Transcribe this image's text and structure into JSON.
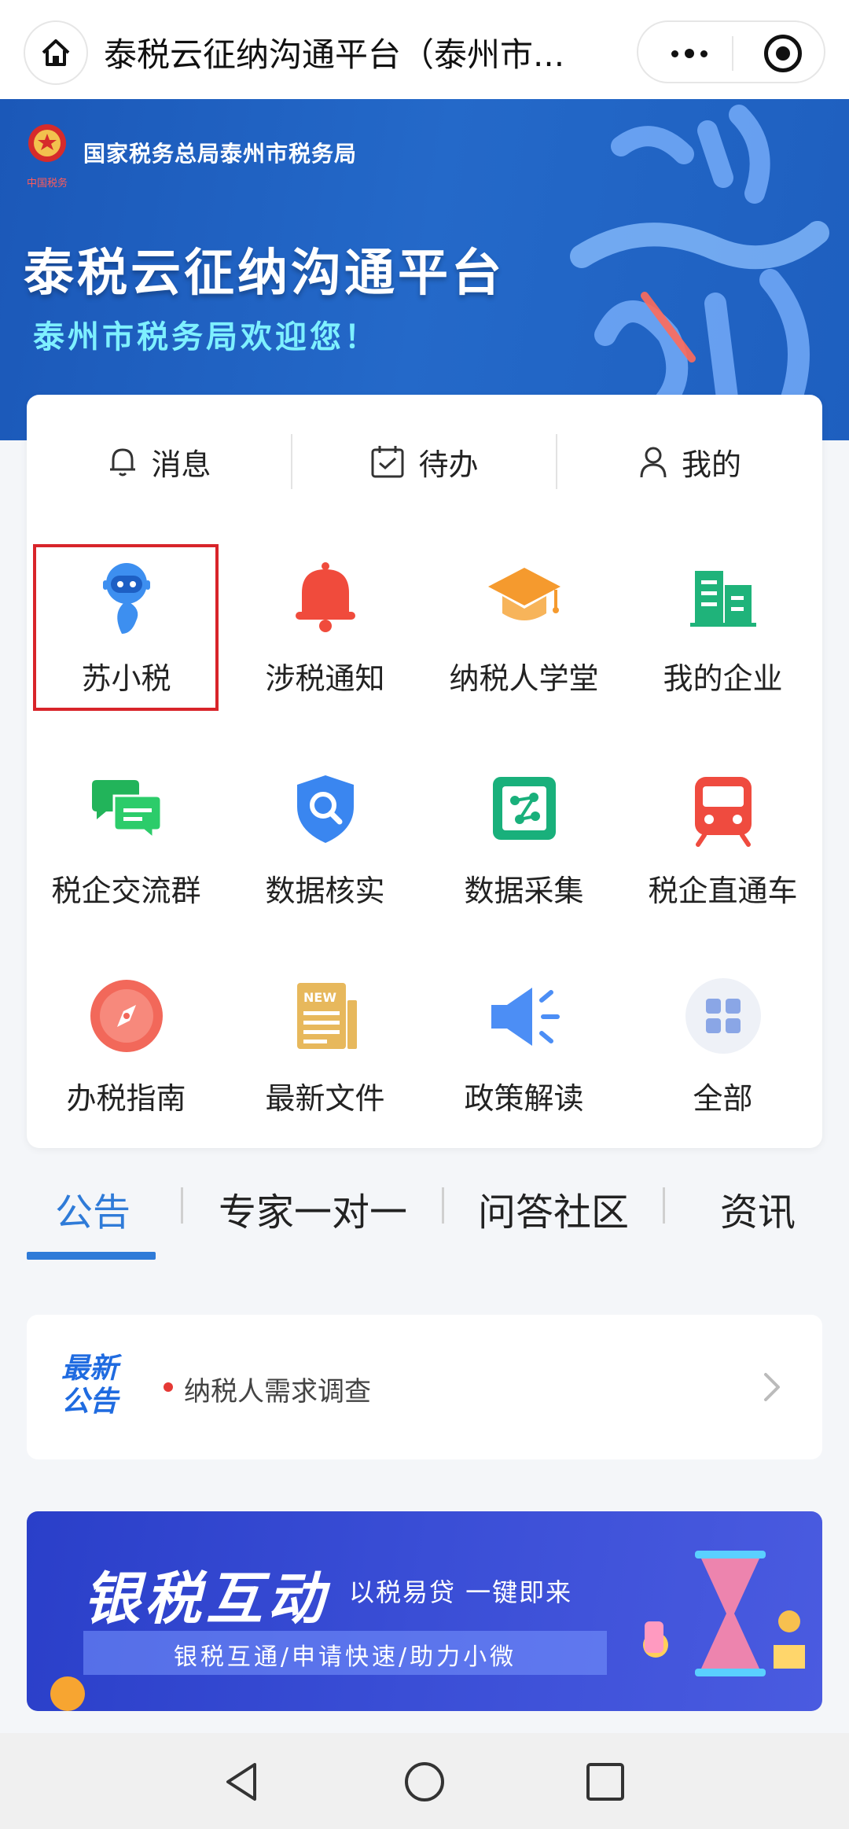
{
  "header": {
    "title": "泰税云征纳沟通平台（泰州市..."
  },
  "banner": {
    "bureau": "国家税务总局泰州市税务局",
    "seal_text": "中国税务",
    "title": "泰税云征纳沟通平台",
    "welcome": "泰州市税务局欢迎您！"
  },
  "quick_actions": [
    {
      "label": "消息",
      "icon": "bell-icon"
    },
    {
      "label": "待办",
      "icon": "calendar-icon"
    },
    {
      "label": "我的",
      "icon": "user-icon"
    }
  ],
  "grid": [
    {
      "label": "苏小税",
      "icon": "robot-icon",
      "color": "#3d8ff0"
    },
    {
      "label": "涉税通知",
      "icon": "bell-icon",
      "color": "#f04b3c"
    },
    {
      "label": "纳税人学堂",
      "icon": "graduation-cap-icon",
      "color": "#f59a2e"
    },
    {
      "label": "我的企业",
      "icon": "building-icon",
      "color": "#1fb37a"
    },
    {
      "label": "税企交流群",
      "icon": "chat-icon",
      "color": "#22b45a"
    },
    {
      "label": "数据核实",
      "icon": "shield-search-icon",
      "color": "#3a86f0"
    },
    {
      "label": "数据采集",
      "icon": "data-collect-icon",
      "color": "#19b07b"
    },
    {
      "label": "税企直通车",
      "icon": "train-icon",
      "color": "#ef4b3f"
    },
    {
      "label": "办税指南",
      "icon": "compass-icon",
      "color": "#f2685a"
    },
    {
      "label": "最新文件",
      "icon": "newspaper-icon",
      "color": "#e7b85c"
    },
    {
      "label": "政策解读",
      "icon": "megaphone-icon",
      "color": "#4c8ef5"
    },
    {
      "label": "全部",
      "icon": "grid-icon",
      "color": "#8aa6e6"
    }
  ],
  "tabs": [
    {
      "label": "公告",
      "active": true
    },
    {
      "label": "专家一对一",
      "active": false
    },
    {
      "label": "问答社区",
      "active": false
    },
    {
      "label": "资讯",
      "active": false
    }
  ],
  "notice": {
    "logo_line1": "最新",
    "logo_line2": "公告",
    "text": "纳税人需求调查"
  },
  "promo": {
    "title": "银税互动",
    "subtitle": "以税易贷  一键即来",
    "tagline": "银税互通/申请快速/助力小微"
  },
  "colors": {
    "accent": "#2f7bd8",
    "highlight_border": "#d8242a",
    "banner_blue": "#1e5fbf"
  }
}
